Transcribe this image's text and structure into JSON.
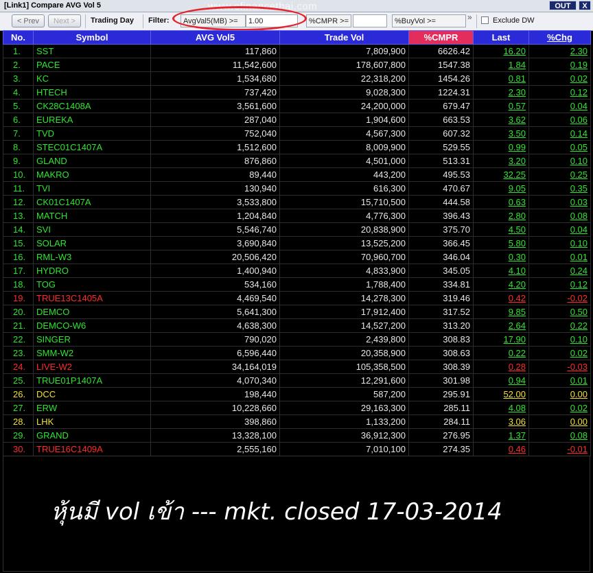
{
  "window": {
    "title": "[Link1] Compare AVG Vol 5",
    "out_label": "OUT",
    "close_label": "X"
  },
  "toolbar": {
    "prev_label": "< Prev",
    "next_label": "Next >",
    "trading_day_label": "Trading Day",
    "filter_label": "Filter:",
    "avgval_label": "AvgVal5(MB) >=",
    "avgval_value": "1.00",
    "cmpr_label": "%CMPR >=",
    "cmpr_value": "",
    "buyvol_label": "%BuyVol >=",
    "chevron": "»",
    "exclude_label": "Exclude DW"
  },
  "watermark": "www.efinancethai.com",
  "colors": {
    "green": "#2ee62e",
    "red": "#ff2a2a",
    "yellow": "#f2e32a",
    "header": "#2a2ad8",
    "header_highlight": "#e32d5c"
  },
  "table": {
    "columns": [
      "No.",
      "Symbol",
      "AVG Vol5",
      "Trade Vol",
      "%CMPR",
      "Last",
      "%Chg"
    ],
    "rows": [
      {
        "no": "1.",
        "symbol": "SST",
        "avg_vol5": "117,860",
        "trade_vol": "7,809,900",
        "cmpr": "6626.42",
        "last": "16.20",
        "chg": "2.30",
        "color": "green"
      },
      {
        "no": "2.",
        "symbol": "PACE",
        "avg_vol5": "11,542,600",
        "trade_vol": "178,607,800",
        "cmpr": "1547.38",
        "last": "1.84",
        "chg": "0.19",
        "color": "green"
      },
      {
        "no": "3.",
        "symbol": "KC",
        "avg_vol5": "1,534,680",
        "trade_vol": "22,318,200",
        "cmpr": "1454.26",
        "last": "0.81",
        "chg": "0.02",
        "color": "green"
      },
      {
        "no": "4.",
        "symbol": "HTECH",
        "avg_vol5": "737,420",
        "trade_vol": "9,028,300",
        "cmpr": "1224.31",
        "last": "2.30",
        "chg": "0.12",
        "color": "green"
      },
      {
        "no": "5.",
        "symbol": "CK28C1408A",
        "avg_vol5": "3,561,600",
        "trade_vol": "24,200,000",
        "cmpr": "679.47",
        "last": "0.57",
        "chg": "0.04",
        "color": "green"
      },
      {
        "no": "6.",
        "symbol": "EUREKA",
        "avg_vol5": "287,040",
        "trade_vol": "1,904,600",
        "cmpr": "663.53",
        "last": "3.62",
        "chg": "0.06",
        "color": "green"
      },
      {
        "no": "7.",
        "symbol": "TVD",
        "avg_vol5": "752,040",
        "trade_vol": "4,567,300",
        "cmpr": "607.32",
        "last": "3.50",
        "chg": "0.14",
        "color": "green"
      },
      {
        "no": "8.",
        "symbol": "STEC01C1407A",
        "avg_vol5": "1,512,600",
        "trade_vol": "8,009,900",
        "cmpr": "529.55",
        "last": "0.99",
        "chg": "0.05",
        "color": "green"
      },
      {
        "no": "9.",
        "symbol": "GLAND",
        "avg_vol5": "876,860",
        "trade_vol": "4,501,000",
        "cmpr": "513.31",
        "last": "3.20",
        "chg": "0.10",
        "color": "green"
      },
      {
        "no": "10.",
        "symbol": "MAKRO",
        "avg_vol5": "89,440",
        "trade_vol": "443,200",
        "cmpr": "495.53",
        "last": "32.25",
        "chg": "0.25",
        "color": "green"
      },
      {
        "no": "11.",
        "symbol": "TVI",
        "avg_vol5": "130,940",
        "trade_vol": "616,300",
        "cmpr": "470.67",
        "last": "9.05",
        "chg": "0.35",
        "color": "green"
      },
      {
        "no": "12.",
        "symbol": "CK01C1407A",
        "avg_vol5": "3,533,800",
        "trade_vol": "15,710,500",
        "cmpr": "444.58",
        "last": "0.63",
        "chg": "0.03",
        "color": "green"
      },
      {
        "no": "13.",
        "symbol": "MATCH",
        "avg_vol5": "1,204,840",
        "trade_vol": "4,776,300",
        "cmpr": "396.43",
        "last": "2.80",
        "chg": "0.08",
        "color": "green"
      },
      {
        "no": "14.",
        "symbol": "SVI",
        "avg_vol5": "5,546,740",
        "trade_vol": "20,838,900",
        "cmpr": "375.70",
        "last": "4.50",
        "chg": "0.04",
        "color": "green"
      },
      {
        "no": "15.",
        "symbol": "SOLAR",
        "avg_vol5": "3,690,840",
        "trade_vol": "13,525,200",
        "cmpr": "366.45",
        "last": "5.80",
        "chg": "0.10",
        "color": "green"
      },
      {
        "no": "16.",
        "symbol": "RML-W3",
        "avg_vol5": "20,506,420",
        "trade_vol": "70,960,700",
        "cmpr": "346.04",
        "last": "0.30",
        "chg": "0.01",
        "color": "green"
      },
      {
        "no": "17.",
        "symbol": "HYDRO",
        "avg_vol5": "1,400,940",
        "trade_vol": "4,833,900",
        "cmpr": "345.05",
        "last": "4.10",
        "chg": "0.24",
        "color": "green"
      },
      {
        "no": "18.",
        "symbol": "TOG",
        "avg_vol5": "534,160",
        "trade_vol": "1,788,400",
        "cmpr": "334.81",
        "last": "4.20",
        "chg": "0.12",
        "color": "green"
      },
      {
        "no": "19.",
        "symbol": "TRUE13C1405A",
        "avg_vol5": "4,469,540",
        "trade_vol": "14,278,300",
        "cmpr": "319.46",
        "last": "0.42",
        "chg": "-0.02",
        "color": "red"
      },
      {
        "no": "20.",
        "symbol": "DEMCO",
        "avg_vol5": "5,641,300",
        "trade_vol": "17,912,400",
        "cmpr": "317.52",
        "last": "9.85",
        "chg": "0.50",
        "color": "green"
      },
      {
        "no": "21.",
        "symbol": "DEMCO-W6",
        "avg_vol5": "4,638,300",
        "trade_vol": "14,527,200",
        "cmpr": "313.20",
        "last": "2.64",
        "chg": "0.22",
        "color": "green"
      },
      {
        "no": "22.",
        "symbol": "SINGER",
        "avg_vol5": "790,020",
        "trade_vol": "2,439,800",
        "cmpr": "308.83",
        "last": "17.90",
        "chg": "0.10",
        "color": "green"
      },
      {
        "no": "23.",
        "symbol": "SMM-W2",
        "avg_vol5": "6,596,440",
        "trade_vol": "20,358,900",
        "cmpr": "308.63",
        "last": "0.22",
        "chg": "0.02",
        "color": "green"
      },
      {
        "no": "24.",
        "symbol": "LIVE-W2",
        "avg_vol5": "34,164,019",
        "trade_vol": "105,358,500",
        "cmpr": "308.39",
        "last": "0.28",
        "chg": "-0.03",
        "color": "red"
      },
      {
        "no": "25.",
        "symbol": "TRUE01P1407A",
        "avg_vol5": "4,070,340",
        "trade_vol": "12,291,600",
        "cmpr": "301.98",
        "last": "0.94",
        "chg": "0.01",
        "color": "green"
      },
      {
        "no": "26.",
        "symbol": "DCC",
        "avg_vol5": "198,440",
        "trade_vol": "587,200",
        "cmpr": "295.91",
        "last": "52.00",
        "chg": "0.00",
        "color": "yellow"
      },
      {
        "no": "27.",
        "symbol": "ERW",
        "avg_vol5": "10,228,660",
        "trade_vol": "29,163,300",
        "cmpr": "285.11",
        "last": "4.08",
        "chg": "0.02",
        "color": "green"
      },
      {
        "no": "28.",
        "symbol": "LHK",
        "avg_vol5": "398,860",
        "trade_vol": "1,133,200",
        "cmpr": "284.11",
        "last": "3.06",
        "chg": "0.00",
        "color": "yellow"
      },
      {
        "no": "29.",
        "symbol": "GRAND",
        "avg_vol5": "13,328,100",
        "trade_vol": "36,912,300",
        "cmpr": "276.95",
        "last": "1.37",
        "chg": "0.08",
        "color": "green"
      },
      {
        "no": "30.",
        "symbol": "TRUE16C1409A",
        "avg_vol5": "2,555,160",
        "trade_vol": "7,010,100",
        "cmpr": "274.35",
        "last": "0.46",
        "chg": "-0.01",
        "color": "red"
      }
    ]
  },
  "caption": "หุ้นมี vol เข้า --- mkt. closed 17-03-2014"
}
